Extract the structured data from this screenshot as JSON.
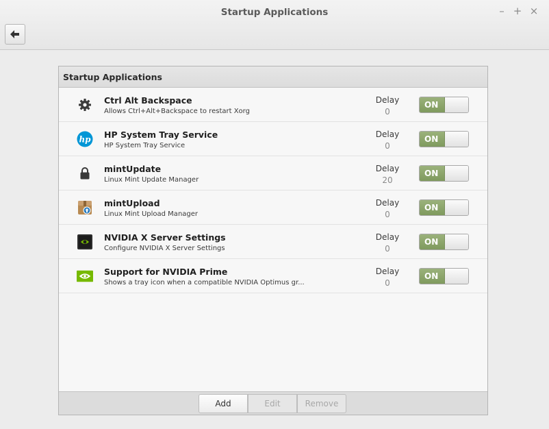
{
  "window": {
    "title": "Startup Applications",
    "controls": {
      "minimize": "–",
      "maximize": "+",
      "close": "×"
    }
  },
  "toolbar": {
    "back_icon": "arrow-left-icon"
  },
  "panel": {
    "header": "Startup Applications",
    "items": [
      {
        "name": "Ctrl Alt Backspace",
        "description": "Allows Ctrl+Alt+Backspace to restart Xorg",
        "delay_label": "Delay",
        "delay": "0",
        "toggle": "ON",
        "icon": "gear-icon"
      },
      {
        "name": "HP System Tray Service",
        "description": "HP System Tray Service",
        "delay_label": "Delay",
        "delay": "0",
        "toggle": "ON",
        "icon": "hp-logo-icon"
      },
      {
        "name": "mintUpdate",
        "description": "Linux Mint Update Manager",
        "delay_label": "Delay",
        "delay": "20",
        "toggle": "ON",
        "icon": "lock-icon"
      },
      {
        "name": "mintUpload",
        "description": "Linux Mint Upload Manager",
        "delay_label": "Delay",
        "delay": "0",
        "toggle": "ON",
        "icon": "upload-box-icon"
      },
      {
        "name": "NVIDIA X Server Settings",
        "description": "Configure NVIDIA X Server Settings",
        "delay_label": "Delay",
        "delay": "0",
        "toggle": "ON",
        "icon": "nvidia-settings-icon"
      },
      {
        "name": "Support for NVIDIA Prime",
        "description": "Shows a tray icon when a compatible NVIDIA Optimus gr...",
        "delay_label": "Delay",
        "delay": "0",
        "toggle": "ON",
        "icon": "nvidia-logo-icon"
      }
    ]
  },
  "footer": {
    "add": "Add",
    "edit": "Edit",
    "remove": "Remove"
  },
  "colors": {
    "toggle_on": "#8aa46a",
    "accent_nvidia": "#76b900",
    "hp_blue": "#0096d6"
  }
}
